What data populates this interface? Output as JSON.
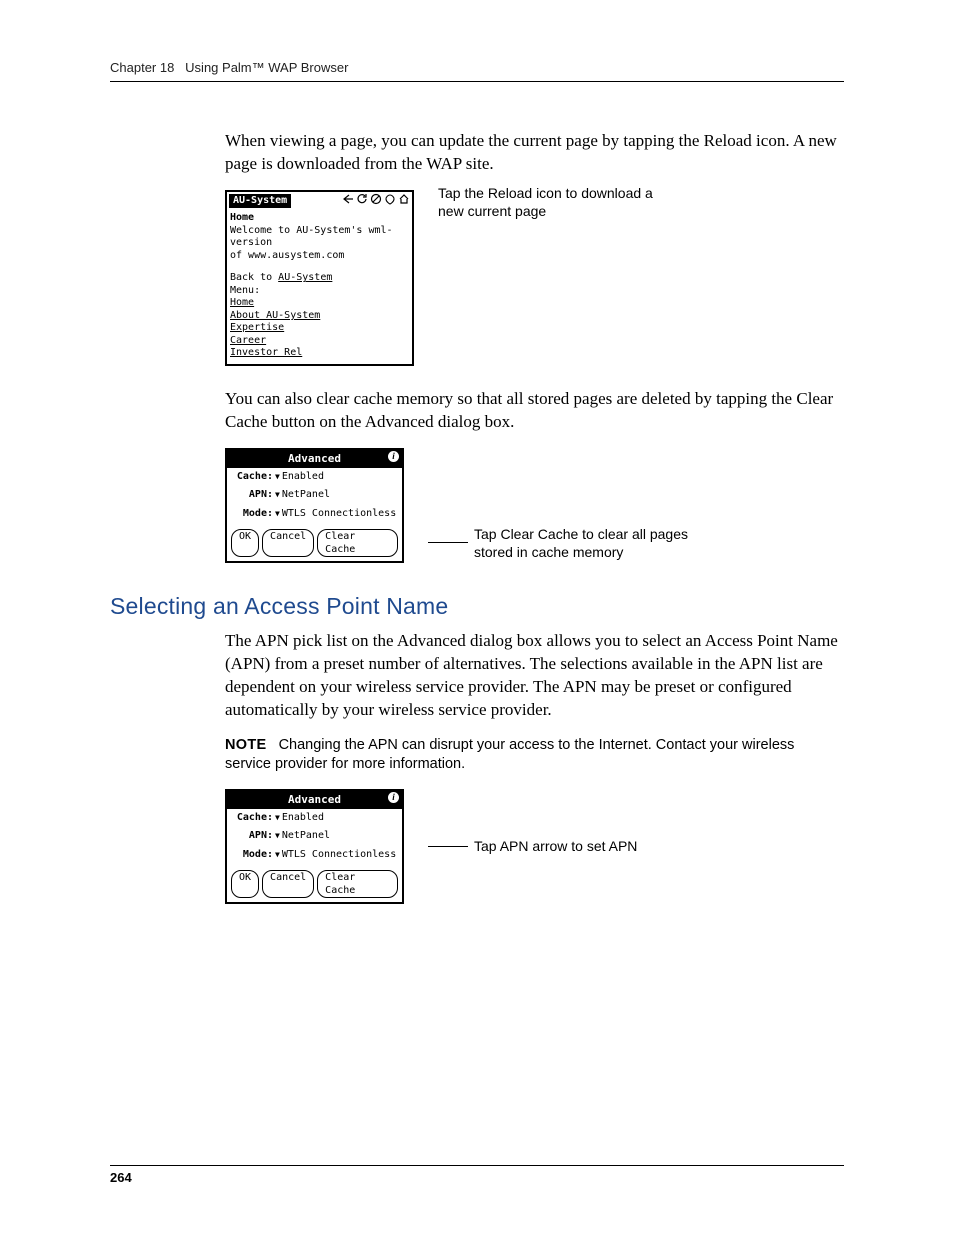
{
  "header": {
    "chapter_label": "Chapter 18",
    "chapter_title": "Using Palm™ WAP Browser"
  },
  "paragraphs": {
    "p1": "When viewing a page, you can update the current page by tapping the Reload icon. A new page is downloaded from the WAP site.",
    "p2": "You can also clear cache memory so that all stored pages are deleted by tapping the Clear Cache button on the Advanced dialog box.",
    "p3": "The APN pick list on the Advanced dialog box allows you to select an Access Point Name (APN) from a preset number of alternatives. The selections available in the APN list are dependent on your wireless service provider. The APN may be preset or configured automatically by your wireless service provider."
  },
  "note": {
    "label": "NOTE",
    "text": "Changing the APN can disrupt your access to the Internet. Contact your wireless service provider for more information."
  },
  "section_heading": "Selecting an Access Point Name",
  "callouts": {
    "reload": "Tap the Reload icon to download a new current page",
    "clear_cache": "Tap Clear Cache to clear all pages stored in cache memory",
    "apn": "Tap APN arrow to set APN"
  },
  "wap_screen": {
    "header_title": "AU-System",
    "body_heading": "Home",
    "welcome_l1": "Welcome to AU-System's wml-version",
    "welcome_l2": "of www.ausystem.com",
    "back_prefix": "Back to ",
    "back_link": "AU-System",
    "menu_label": "Menu:",
    "links": [
      "Home",
      "About AU-System",
      "Expertise",
      "Career",
      "Investor Rel"
    ],
    "icon_names": [
      "back-icon",
      "reload-icon",
      "stop-icon",
      "bookmark-icon",
      "home-icon"
    ]
  },
  "advanced_dialog": {
    "title": "Advanced",
    "info_glyph": "i",
    "rows": {
      "cache": {
        "label": "Cache:",
        "value": "Enabled"
      },
      "apn": {
        "label": "APN:",
        "value": "NetPanel"
      },
      "mode": {
        "label": "Mode:",
        "value": "WTLS Connectionless"
      }
    },
    "buttons": {
      "ok": "OK",
      "cancel": "Cancel",
      "clear_cache": "Clear Cache"
    }
  },
  "page_number": "264"
}
